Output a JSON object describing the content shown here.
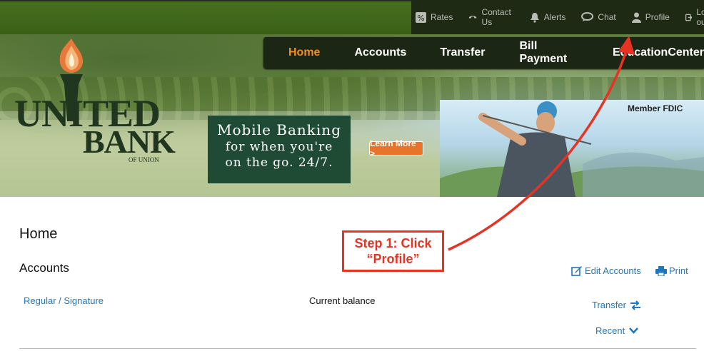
{
  "utility_nav": {
    "items": [
      {
        "label": "Rates",
        "icon": "percent-icon"
      },
      {
        "label": "Contact Us",
        "icon": "phone-icon"
      },
      {
        "label": "Alerts",
        "icon": "bell-icon"
      },
      {
        "label": "Chat",
        "icon": "chat-icon"
      },
      {
        "label": "Profile",
        "icon": "user-icon"
      },
      {
        "label": "Log out",
        "icon": "logout-icon"
      }
    ]
  },
  "main_nav": {
    "items": [
      "Home",
      "Accounts",
      "Transfer",
      "Bill Payment",
      "EducationCenter"
    ],
    "active": "Home"
  },
  "brand": {
    "line1": "UNITED",
    "line2": "BANK",
    "line3": "OF UNION"
  },
  "promo": {
    "line1": "Mobile Banking",
    "line2": "for when you're",
    "line3": "on the go. 24/7.",
    "button": "Learn More >"
  },
  "member_fdic": "Member FDIC",
  "page": {
    "title": "Home",
    "section": "Accounts",
    "edit_accounts": "Edit Accounts",
    "print": "Print",
    "account_name": "Regular / Signature",
    "current_balance_label": "Current balance",
    "transfer": "Transfer",
    "recent": "Recent"
  },
  "callout": {
    "line1": "Step 1: Click",
    "line2": "“Profile”"
  },
  "colors": {
    "accent_orange": "#f28d27",
    "link_blue": "#1b78c2",
    "callout_red": "#e63323",
    "nav_dark": "#1c2614",
    "brand_green": "#20361f"
  }
}
